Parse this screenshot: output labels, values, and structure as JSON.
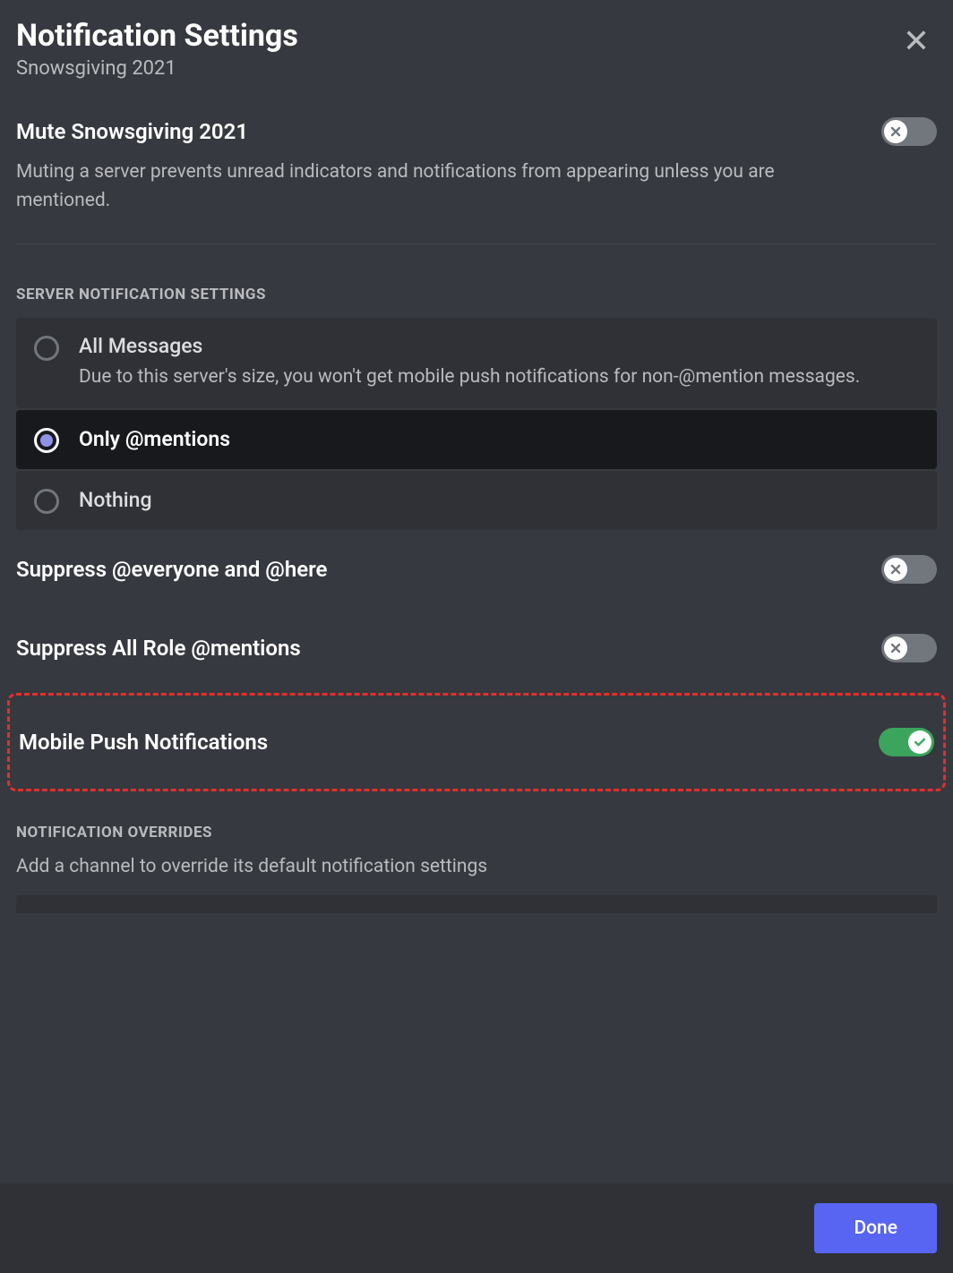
{
  "header": {
    "title": "Notification Settings",
    "subtitle": "Snowsgiving 2021"
  },
  "mute": {
    "label": "Mute Snowsgiving 2021",
    "description": "Muting a server prevents unread indicators and notifications from appearing unless you are mentioned.",
    "enabled": false
  },
  "server_settings": {
    "header": "SERVER NOTIFICATION SETTINGS",
    "options": [
      {
        "label": "All Messages",
        "description": "Due to this server's size, you won't get mobile push notifications for non-@mention messages.",
        "selected": false
      },
      {
        "label": "Only @mentions",
        "selected": true
      },
      {
        "label": "Nothing",
        "selected": false
      }
    ]
  },
  "toggles": {
    "suppress_everyone": {
      "label": "Suppress @everyone and @here",
      "enabled": false
    },
    "suppress_roles": {
      "label": "Suppress All Role @mentions",
      "enabled": false
    },
    "mobile_push": {
      "label": "Mobile Push Notifications",
      "enabled": true
    }
  },
  "overrides": {
    "header": "NOTIFICATION OVERRIDES",
    "description": "Add a channel to override its default notification settings"
  },
  "footer": {
    "done_label": "Done"
  }
}
